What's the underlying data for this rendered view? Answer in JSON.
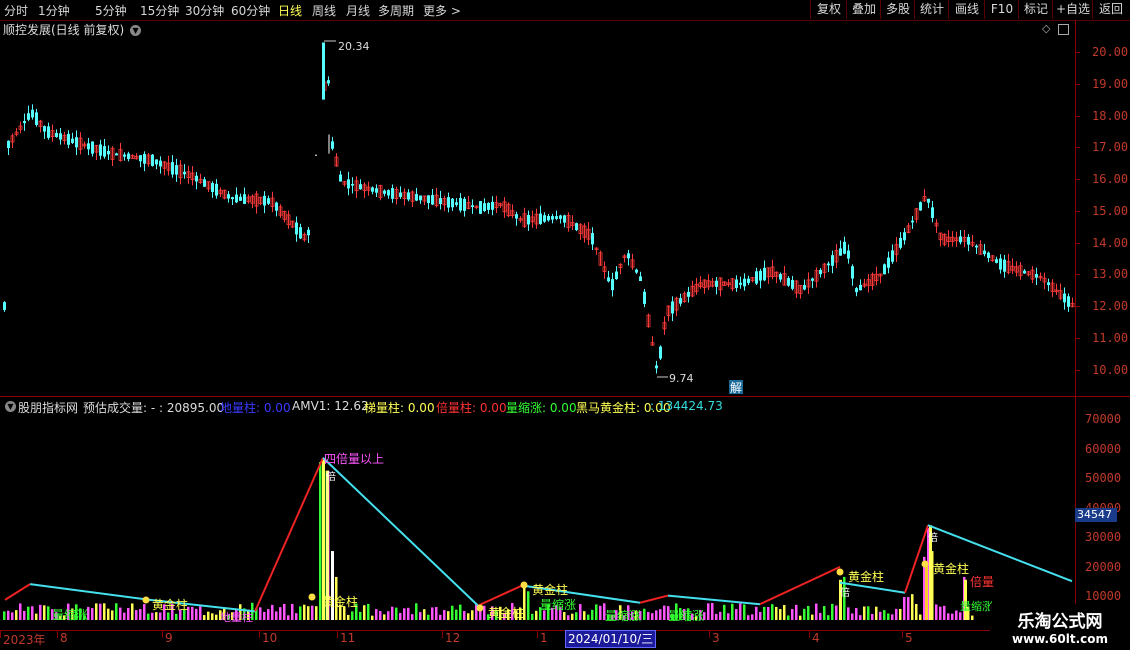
{
  "toolbar": {
    "periods": [
      {
        "label": "分时",
        "active": false
      },
      {
        "label": "1分钟",
        "active": false
      },
      {
        "label": "5分钟",
        "active": false
      },
      {
        "label": "15分钟",
        "active": false
      },
      {
        "label": "30分钟",
        "active": false
      },
      {
        "label": "60分钟",
        "active": false
      },
      {
        "label": "日线",
        "active": true
      },
      {
        "label": "周线",
        "active": false
      },
      {
        "label": "月线",
        "active": false
      },
      {
        "label": "多周期",
        "active": false
      },
      {
        "label": "更多 >",
        "active": false
      }
    ],
    "right_buttons": [
      "复权",
      "叠加",
      "多股",
      "统计",
      "画线",
      "F10",
      "标记",
      "+自选",
      "返回"
    ]
  },
  "main_panel": {
    "title": "顺控发展(日线 前复权)",
    "y_ticks": [
      "20.00",
      "19.00",
      "18.00",
      "17.00",
      "16.00",
      "15.00",
      "14.00",
      "13.00",
      "12.00",
      "11.00",
      "10.00"
    ],
    "high_label": "20.34",
    "low_label": "9.74",
    "jie_label": "解"
  },
  "indicator": {
    "name": "股朋指标网",
    "fields": [
      {
        "text": "预估成交量: - : 20895.00",
        "color": "#dcdcdc"
      },
      {
        "text": "地量柱: 0.00",
        "color": "#3a3aff"
      },
      {
        "text": "AMV1: 12.62",
        "color": "#dcdcdc"
      },
      {
        "text": "梯量柱: 0.00",
        "color": "#ffff55"
      },
      {
        "text": "倍量柱: 0.00",
        "color": "#ff3333"
      },
      {
        "text": "量缩涨: 0.00",
        "color": "#33ff33"
      },
      {
        "text": "黑马黄金柱: 0.00",
        "color": "#ffff55"
      },
      {
        "text": ": 134424.73",
        "color": "#33dddd"
      }
    ],
    "y_ticks": [
      "70000",
      "60000",
      "50000",
      "40000",
      "30000",
      "20000",
      "10000"
    ],
    "current_value": "34547",
    "annotations": {
      "four_times": "四倍量以上",
      "bei": "倍",
      "gold": "黄金柱",
      "shrink": "量缩涨",
      "bei_liang": "倍量",
      "shrink_up": "量缩涨",
      "di_liang": "地量柱"
    }
  },
  "x_axis": {
    "labels": [
      "2023年",
      "8",
      "9",
      "10",
      "11",
      "12",
      "1",
      "2",
      "3",
      "4",
      "5"
    ],
    "cursor_date": "2024/01/10/三"
  },
  "watermark": {
    "title": "乐淘公式网",
    "url": "www.60lt.com"
  },
  "colors": {
    "up": "#ff3a3a",
    "down": "#55ffff",
    "axis": "#8a0000",
    "gold": "#ffff55",
    "label_red": "#c0392b"
  }
}
